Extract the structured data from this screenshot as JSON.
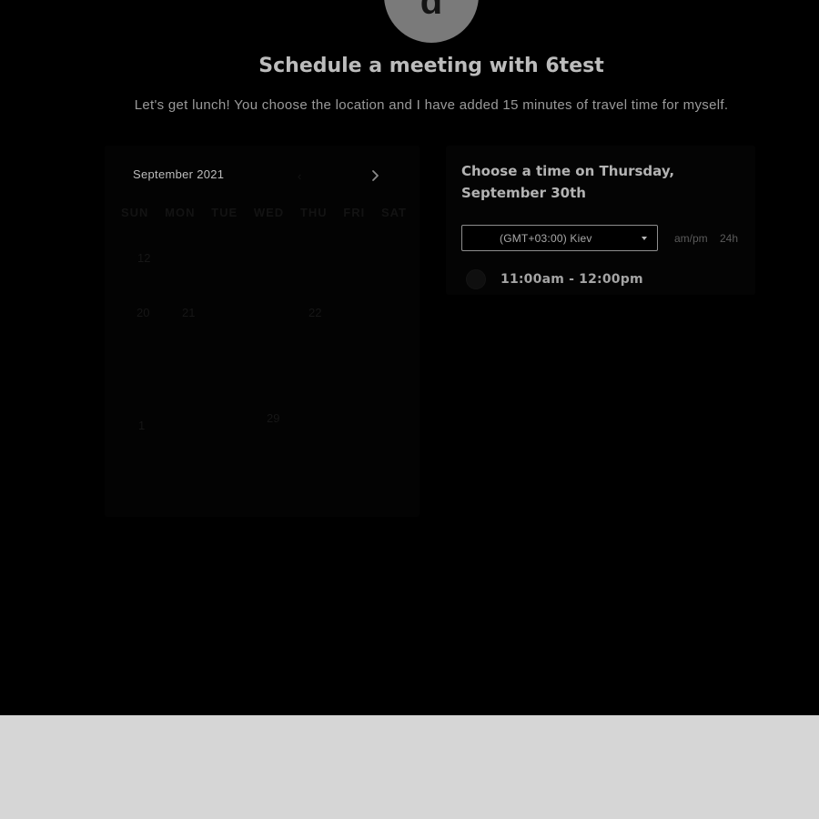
{
  "host": {
    "avatar_initial": "d"
  },
  "header": {
    "title": "Schedule a meeting with 6test",
    "description": "Let's get lunch! You choose the location and I have added 15 minutes of travel time for myself."
  },
  "calendar": {
    "month_label": "September 2021",
    "prev_label": "‹",
    "weekdays": [
      "SUN",
      "MON",
      "TUE",
      "WED",
      "THU",
      "FRI",
      "SAT"
    ],
    "faint_days": [
      "12",
      "20",
      "21",
      "22",
      "1",
      "29"
    ]
  },
  "time_picker": {
    "heading": "Choose a time on Thursday, September 30th",
    "timezone": "(GMT+03:00) Kiev",
    "format_ampm": "am/pm",
    "format_24h": "24h",
    "slots": [
      {
        "label": "11:00am - 12:00pm"
      }
    ]
  },
  "colors": {
    "page_background": "#000000",
    "footer_background": "#d6d6d6",
    "avatar": "#7a7a7a",
    "heading_text": "#bcbcbc"
  }
}
